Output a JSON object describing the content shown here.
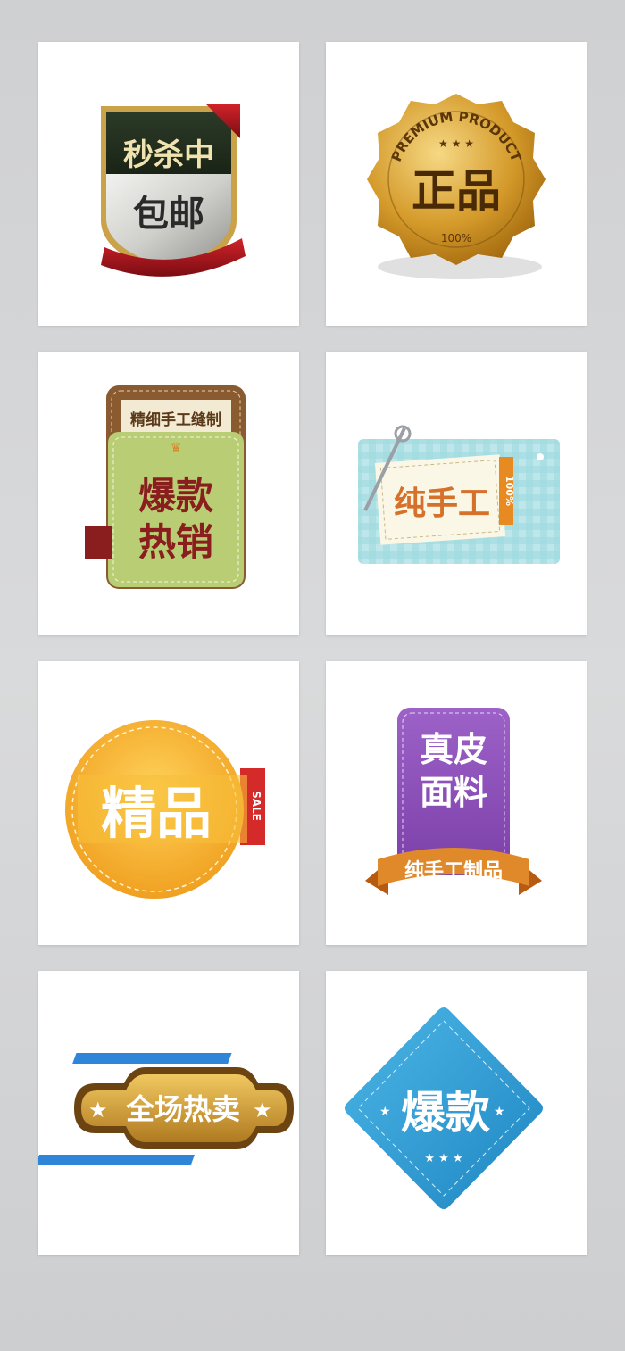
{
  "badges": {
    "b1": {
      "top": "秒杀中",
      "bottom": "包邮"
    },
    "b2": {
      "arc": "PREMIUM PRODUCT",
      "main": "正品",
      "percent": "100%"
    },
    "b3": {
      "header": "精细手工缝制",
      "line1": "爆款",
      "line2": "热销"
    },
    "b4": {
      "main": "纯手工",
      "side": "100%"
    },
    "b5": {
      "main": "精品",
      "side": "SALE"
    },
    "b6": {
      "line1": "真皮",
      "line2": "面料",
      "ribbon": "纯手工制品"
    },
    "b7": {
      "main": "全场热卖"
    },
    "b8": {
      "main": "爆款"
    }
  },
  "colors": {
    "gold": "#d49a2a",
    "green_label": "#b9cd74",
    "purple": "#8a4fb8",
    "blue": "#2fa0d8",
    "dark_red": "#8a1d1d"
  }
}
